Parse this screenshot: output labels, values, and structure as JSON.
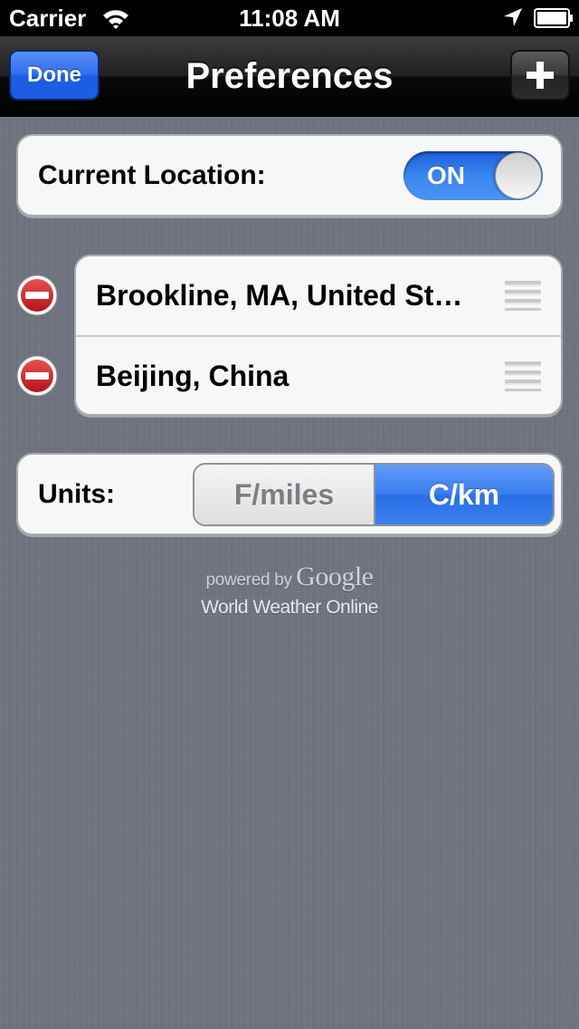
{
  "status_bar": {
    "carrier": "Carrier",
    "time": "11:08 AM",
    "icons": [
      "wifi-icon",
      "location-arrow-icon",
      "battery-icon"
    ]
  },
  "nav": {
    "title": "Preferences",
    "done_label": "Done",
    "add_icon": "plus-icon"
  },
  "location": {
    "label": "Current Location:",
    "toggle_state": "ON"
  },
  "locations": {
    "items": [
      {
        "label": "Brookline, MA, United St…"
      },
      {
        "label": "Beijing, China"
      }
    ]
  },
  "units": {
    "label": "Units:",
    "options": [
      "F/miles",
      "C/km"
    ],
    "selected": "C/km"
  },
  "attribution": {
    "powered_prefix": "powered by",
    "google": "Google",
    "provider": "World Weather Online"
  },
  "colors": {
    "accent_blue": "#2e6ff0",
    "delete_red": "#cc1f1f",
    "background": "#6f737d"
  }
}
